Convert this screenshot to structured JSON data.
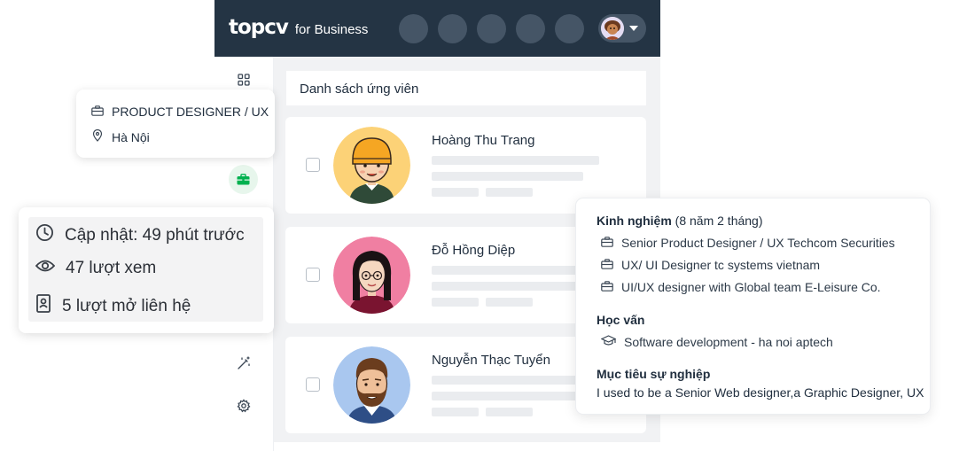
{
  "brand": {
    "logo_text": "topcv",
    "sub_text": "for Business",
    "colors": {
      "navy": "#243444",
      "accent_green": "#00b14f"
    }
  },
  "topbar": {
    "nav_icons": [
      "nav-icon",
      "nav-icon",
      "nav-icon",
      "nav-icon",
      "nav-icon"
    ],
    "profile_menu_icon": "caret-down-icon"
  },
  "sidebar": {
    "icons": [
      "grid-icon",
      "briefcase-icon",
      "magic-wand-icon",
      "settings-icon"
    ]
  },
  "job_popup": {
    "title": "PRODUCT DESIGNER / UX",
    "location": "Hà Nội"
  },
  "stats_popup": {
    "updated": "Cập nhật: 49 phút trước",
    "views": "47 lượt xem",
    "contacts": "5 lượt mở liên hệ"
  },
  "list": {
    "title": "Danh sách ứng viên",
    "candidates": [
      {
        "name": "Hoàng Thu Trang"
      },
      {
        "name": "Đỗ Hồng Diệp"
      },
      {
        "name": "Nguyễn Thạc Tuyển"
      }
    ]
  },
  "detail_popup": {
    "experience_label": "Kinh nghiệm",
    "experience_duration": "(8 năm 2 tháng)",
    "experience": [
      "Senior Product Designer / UX Techcom Securities",
      "UX/ UI Designer tc systems vietnam",
      "UI/UX designer with Global team E-Leisure Co."
    ],
    "education_label": "Học vấn",
    "education": [
      "Software development - ha noi aptech"
    ],
    "objective_label": "Mục tiêu sự nghiệp",
    "objective": "I used to be a Senior Web designer,a Graphic Designer, UX"
  }
}
